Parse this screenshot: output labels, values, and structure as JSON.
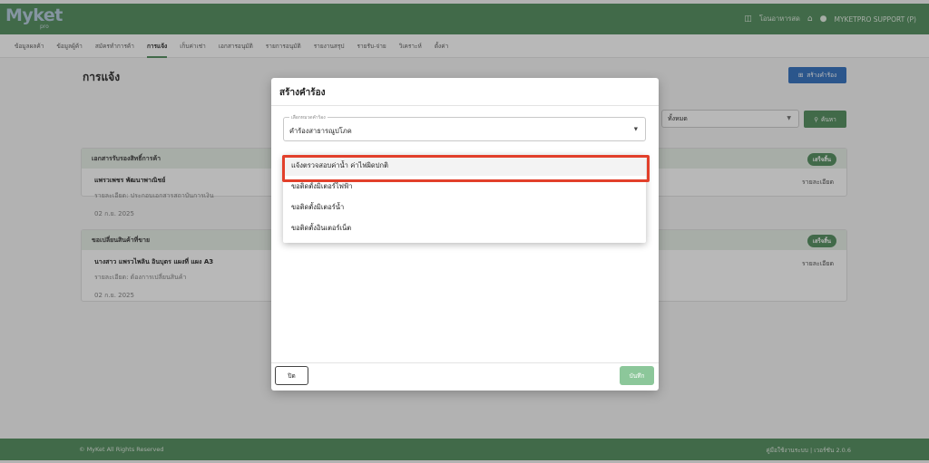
{
  "header": {
    "logo": "Myket",
    "logo_sub": "pro",
    "icon_mail": "mailbox-icon",
    "mail_label": "โอนอาหารสด",
    "icon_home": "home-icon",
    "icon_user": "user-icon",
    "user_label": "MYKETPRO SUPPORT (P)"
  },
  "nav": {
    "items": [
      {
        "label": "ข้อมูลผลค้า"
      },
      {
        "label": "ข้อมูลผู้ค้า"
      },
      {
        "label": "สมัครทำการค้า"
      },
      {
        "label": "การแจ้ง"
      },
      {
        "label": "เก็บค่าเช่า"
      },
      {
        "label": "เอกสารอนุมัติ"
      },
      {
        "label": "รายการอนุมัติ"
      },
      {
        "label": "รายงานสรุป"
      },
      {
        "label": "รายรับ-จ่าย"
      },
      {
        "label": "วิเคราะห์"
      },
      {
        "label": "ตั้งค่า"
      }
    ]
  },
  "page": {
    "title": "การแจ้ง",
    "create_button": "สร้างคำร้อง",
    "filter_value": "ทั้งหมด",
    "search_button": "ค้นหา"
  },
  "cards": [
    {
      "header": "เอกสารรับรองสิทธิ์การค้า",
      "status": "เสร็จสิ้น",
      "name": "แพรวเพชร พัฒนาพาณิชย์",
      "detail": "รายละเอียด: ประกอบเอกสารสถาบันการเงิน",
      "date": "02 ก.ย. 2025",
      "detail_link": "รายละเอียด"
    },
    {
      "header": "ขอเปลี่ยนสินค้าที่ขาย",
      "status": "เสร็จสิ้น",
      "name": "นางสาว แพรวไพลิน อินบุตร แผงที่ แผง A3",
      "detail": "รายละเอียด: ต้องการเปลี่ยนสินค้า",
      "date": "02 ก.ย. 2025",
      "detail_link": "รายละเอียด"
    }
  ],
  "footer": {
    "left": "© MyKet All Rights Reserved",
    "right": "คู่มือใช้งานระบบ | เวอร์ชัน 2.0.6"
  },
  "modal": {
    "title": "สร้างคำร้อง",
    "field_label": "เลือกหมวดคำร้อง",
    "field_value": "คำร้องสาธารณูปโภค",
    "options": [
      {
        "label": "แจ้งตรวจสอบค่าน้ำ ค่าไฟผิดปกติ"
      },
      {
        "label": "ขอติดตั้งมิเตอร์ไฟฟ้า"
      },
      {
        "label": "ขอติดตั้งมิเตอร์น้ำ"
      },
      {
        "label": "ขอติดตั้งอินเตอร์เน็ต"
      }
    ],
    "close_button": "ปิด",
    "save_button": "บันทึก"
  }
}
